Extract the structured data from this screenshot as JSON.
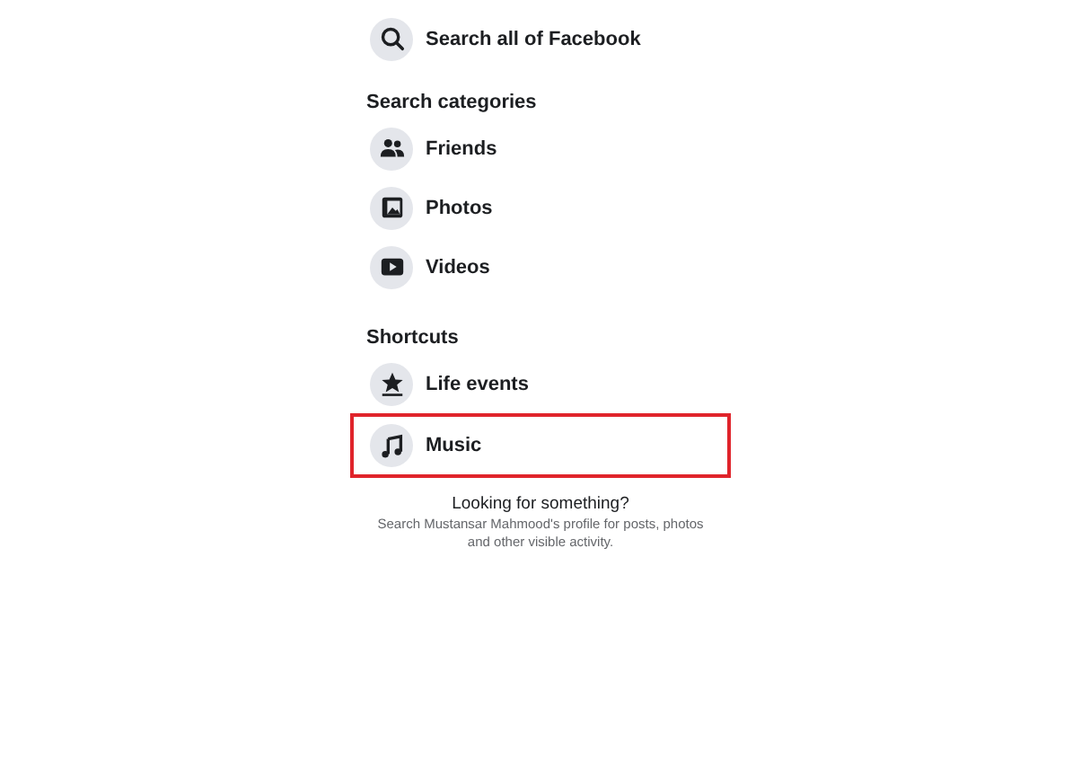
{
  "search_all": {
    "label": "Search all of Facebook"
  },
  "sections": [
    {
      "heading": "Search categories",
      "items": [
        {
          "label": "Friends",
          "highlighted": false
        },
        {
          "label": "Photos",
          "highlighted": false
        },
        {
          "label": "Videos",
          "highlighted": false
        }
      ]
    },
    {
      "heading": "Shortcuts",
      "items": [
        {
          "label": "Life events",
          "highlighted": false
        },
        {
          "label": "Music",
          "highlighted": true
        }
      ]
    }
  ],
  "footer": {
    "title": "Looking for something?",
    "text": "Search Mustansar Mahmood's profile for posts, photos and other visible activity."
  }
}
